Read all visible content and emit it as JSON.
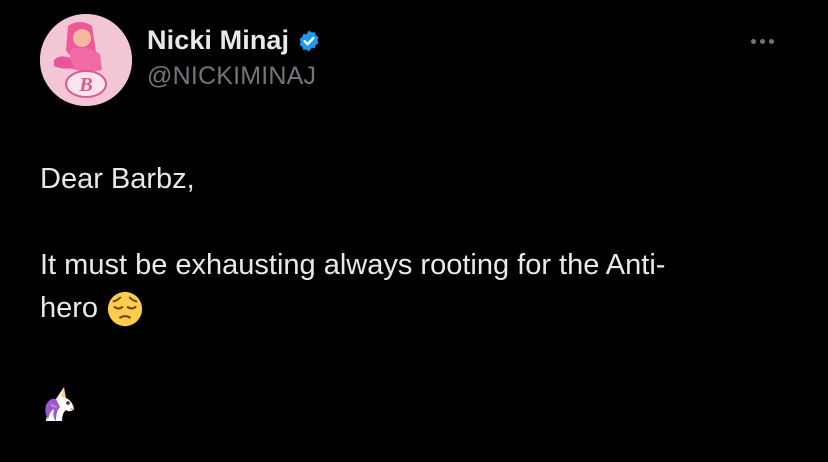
{
  "author": {
    "display_name": "Nicki Minaj",
    "handle": "@NICKIMINAJ",
    "verified_icon": "verified-badge-icon",
    "avatar_badge_letter": "B"
  },
  "post": {
    "line1": "Dear Barbz,",
    "line2": "It must be exhausting always rooting for the Anti-",
    "line3": "hero",
    "line3_emoji": "pensive-face-emoji",
    "line4_emoji": "unicorn-emoji"
  },
  "colors": {
    "background": "#000000",
    "text": "#e7e9ea",
    "muted": "#71767b",
    "verified": "#1d9bf0"
  }
}
